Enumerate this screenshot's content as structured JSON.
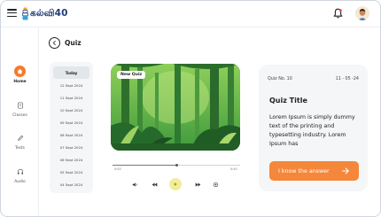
{
  "app": {
    "logo_text": "கல்வி40"
  },
  "header": {
    "menu_icon": "hamburger-icon",
    "notification_icon": "bell-icon",
    "avatar_icon": "user-avatar"
  },
  "sidebar": {
    "items": [
      {
        "label": "Home",
        "icon": "home-icon",
        "active": true
      },
      {
        "label": "Classes",
        "icon": "book-icon",
        "active": false
      },
      {
        "label": "Tests",
        "icon": "pencil-icon",
        "active": false
      },
      {
        "label": "Audio",
        "icon": "headphones-icon",
        "active": false
      }
    ]
  },
  "page": {
    "title": "Quiz",
    "back_icon": "back-arrow-icon"
  },
  "dates": {
    "items": [
      "Today",
      "12 Sept 2024",
      "11 Sept 2024",
      "10 Sept 2024",
      "09 Sept 2024",
      "08 Sept 2024",
      "07 Sept 2024",
      "06 Sept 2024",
      "05 Sept 2024",
      "04 Sept 2024"
    ],
    "selected": "Today"
  },
  "video": {
    "badge": "New Quiz"
  },
  "player": {
    "current_time": "0:00",
    "duration": "0:40",
    "progress": 0.5,
    "controls": [
      "volume-icon",
      "rewind-icon",
      "play-icon",
      "fast-forward-icon",
      "settings-icon"
    ]
  },
  "quiz": {
    "number": "Quiz No. 10",
    "date": "11 - 05 -24",
    "title": "Quiz Title",
    "body": "Lorem Ipsum is simply dummy text of the printing and typesetting industry. Lorem Ipsum has",
    "answer_label": "I know the answer"
  },
  "colors": {
    "accent": "#f5873a",
    "active_nav": "#f47b2a",
    "brand": "#1f3d7a",
    "play_button": "#f3ec9a"
  }
}
